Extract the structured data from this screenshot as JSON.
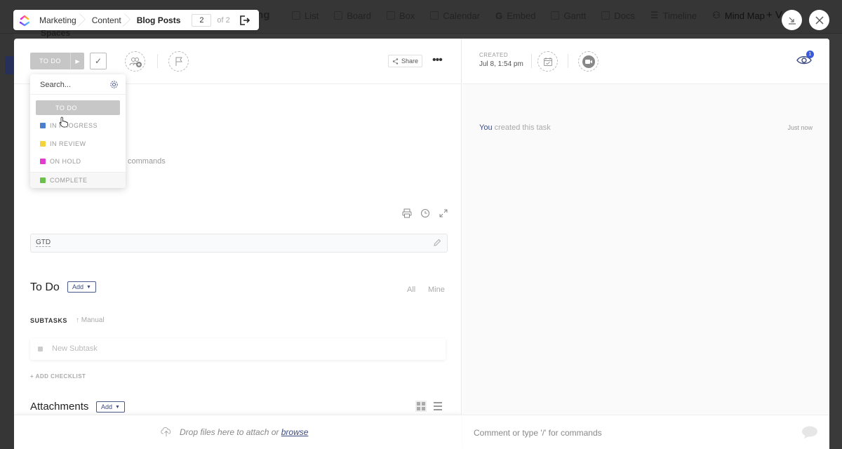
{
  "background": {
    "title_fragment": "ing",
    "spaces_label": "Spaces",
    "views": [
      {
        "label": "List",
        "icon": "list-icon"
      },
      {
        "label": "Board",
        "icon": "board-icon"
      },
      {
        "label": "Box",
        "icon": "box-icon"
      },
      {
        "label": "Calendar",
        "icon": "calendar-icon"
      },
      {
        "label": "Embed",
        "icon": "embed-icon"
      },
      {
        "label": "Gantt",
        "icon": "gantt-icon"
      },
      {
        "label": "Docs",
        "icon": "docs-icon"
      },
      {
        "label": "Timeline",
        "icon": "timeline-icon"
      },
      {
        "label": "Mind Map",
        "icon": "mind-map-icon"
      }
    ],
    "add_view_label": "+ V"
  },
  "breadcrumb": {
    "items": [
      "Marketing",
      "Content",
      "Blog Posts"
    ],
    "page_current": "2",
    "page_total_label": "of 2"
  },
  "task": {
    "status": "TO DO",
    "share_label": "Share",
    "more_label": "•••",
    "created_label": "CREATED",
    "created_value": "Jul 8, 1:54 pm",
    "watchers_count": "1",
    "description_hint": "commands",
    "tag": "GTD",
    "todo_title": "To Do",
    "add_label": "Add",
    "filter_all": "All",
    "filter_mine": "Mine",
    "subtasks_label": "SUBTASKS",
    "sort_label": "Manual",
    "new_subtask_placeholder": "New Subtask",
    "add_checklist_label": "+ ADD CHECKLIST",
    "attachments_title": "Attachments",
    "drop_text": "Drop files here to attach or ",
    "browse_label": "browse"
  },
  "activity": {
    "actor": "You",
    "action": " created this task",
    "time": "Just now"
  },
  "comment": {
    "placeholder": "Comment or type '/' for commands"
  },
  "status_menu": {
    "search_placeholder": "Search...",
    "items": [
      {
        "label": "TO DO",
        "color": "#c7c7c7",
        "selected": true
      },
      {
        "label": "IN PROGRESS",
        "color": "#4a7fd0"
      },
      {
        "label": "IN REVIEW",
        "color": "#f3d23b"
      },
      {
        "label": "ON HOLD",
        "color": "#e03cd0"
      },
      {
        "label": "COMPLETE",
        "color": "#6bc04b"
      }
    ]
  }
}
